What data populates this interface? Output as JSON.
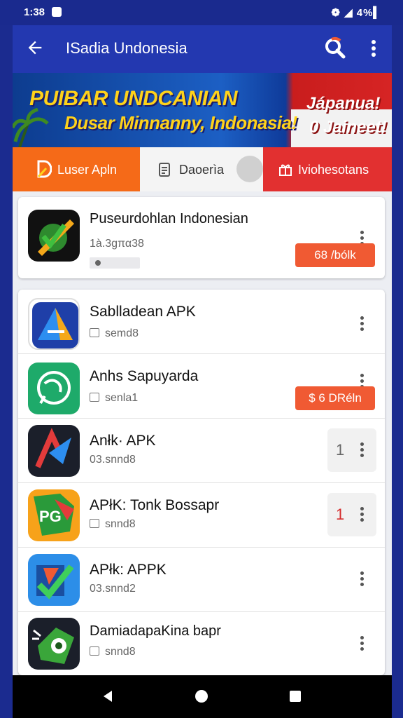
{
  "status": {
    "time": "1:38",
    "right": "❁ ◢ 4%▍"
  },
  "appbar": {
    "title": "ISadia Undonesia"
  },
  "banner": {
    "line1": "PUIBAR UNDCANIAN",
    "line2": "Dusar Minnanny, Indonasia!",
    "right1": "Jápanua!",
    "right2": "0 Jaineet!"
  },
  "tabs": [
    {
      "label": "Luser Apln"
    },
    {
      "label": "Daoerìa"
    },
    {
      "label": "Iviohesotans"
    }
  ],
  "featured": {
    "name": "Puseurdohlan Indonesian",
    "sub": "1à.3gπα38",
    "button": "68 /bólk"
  },
  "apps": [
    {
      "name": "Sablladean APK",
      "sub": "semd8",
      "action": null,
      "badge": null
    },
    {
      "name": "Anhs Sapuyarda",
      "sub": "senla1",
      "action": "$ 6 DRéln",
      "badge": null
    },
    {
      "name": "Anłk· APK",
      "sub": "03.snnd8",
      "action": null,
      "badge": "1"
    },
    {
      "name": "APłK: Tonk Bossapr",
      "sub": "snnd8",
      "action": null,
      "badge": "1"
    },
    {
      "name": "APłk: APPK",
      "sub": "03.snnd2",
      "action": null,
      "badge": null
    },
    {
      "name": "DamiadapaKina bapr",
      "sub": "snnd8",
      "action": null,
      "badge": null
    }
  ],
  "colors": {
    "primary": "#2338b0",
    "orange": "#f56a18",
    "red": "#e23030",
    "action": "#f05a33"
  }
}
